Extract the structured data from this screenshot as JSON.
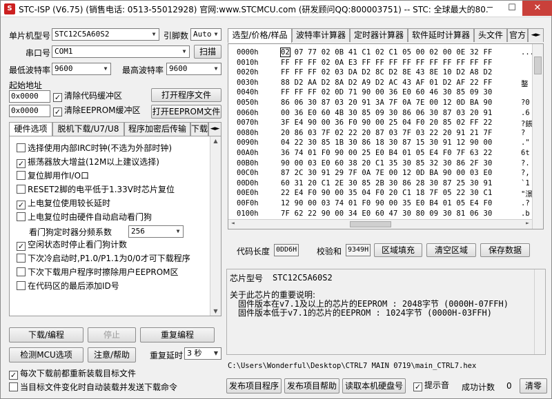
{
  "window": {
    "title": "STC-ISP (V6.75) (销售电话: 0513-55012928) 官网:www.STCMCU.com  (研发顾问QQ:800003751)  -- STC: 全球最大的80...",
    "min": "─",
    "max": "☐",
    "close": "✕"
  },
  "left": {
    "mcu_type_label": "单片机型号",
    "mcu_type_value": "STC12C5A60S2",
    "pins_label": "引脚数",
    "pins_value": "Auto",
    "port_label": "串口号",
    "port_value": "COM1",
    "scan_button": "扫描",
    "min_baud_label": "最低波特率",
    "min_baud_value": "9600",
    "max_baud_label": "最高波特率",
    "max_baud_value": "9600",
    "start_addr_label": "起始地址",
    "code_addr": "0x0000",
    "clear_code_label": "清除代码缓冲区",
    "open_program_button": "打开程序文件",
    "eeprom_addr": "0x0000",
    "clear_eeprom_label": "清除EEPROM缓冲区",
    "open_eeprom_button": "打开EEPROM文件"
  },
  "left_tabs": [
    "硬件选项",
    "脱机下载/U7/U8",
    "程序加密后传输",
    "下载"
  ],
  "options": [
    {
      "label": "选择使用内部IRC时钟(不选为外部时钟)",
      "checked": false
    },
    {
      "label": "振荡器放大增益(12M以上建议选择)",
      "checked": true
    },
    {
      "label": "复位脚用作I/O口",
      "checked": false
    },
    {
      "label": "RESET2脚的电平低于1.33V时芯片复位",
      "checked": false
    },
    {
      "label": "上电复位使用较长延时",
      "checked": true
    },
    {
      "label": "上电复位时由硬件自动启动看门狗",
      "checked": false
    }
  ],
  "watchdog": {
    "label": "看门狗定时器分频系数",
    "value": "256"
  },
  "options2": [
    {
      "label": "空闲状态时停止看门狗计数",
      "checked": true
    },
    {
      "label": "下次冷启动时,P1.0/P1.1为0/0才可下载程序",
      "checked": false
    },
    {
      "label": "下次下载用户程序时擦除用户EEPROM区",
      "checked": false
    },
    {
      "label": "在代码区的最后添加ID号",
      "checked": false
    }
  ],
  "actions": {
    "download": "下载/编程",
    "stop": "停止",
    "redownload": "重复编程",
    "check_mcu": "检测MCU选项",
    "help": "注意/帮助",
    "repeat_delay_label": "重复延时",
    "repeat_delay_value": "3 秒",
    "reload_each": "每次下载前都重新装载目标文件",
    "auto_reload": "当目标文件变化时自动装载并发送下载命令"
  },
  "right_tabs": [
    "选型/价格/样品",
    "波特率计算器",
    "定时器计算器",
    "软件延时计算器",
    "头文件",
    "官方"
  ],
  "hex": {
    "rows": [
      {
        "addr": "0000h",
        "bytes": "02 07 77 02 0B 41 C1 02 C1 05 00 02 00 0E 32 FF",
        "ascii": "..."
      },
      {
        "addr": "0010h",
        "bytes": "FF FF FF 02 0A E3 FF FF FF FF FF FF FF FF FF FF",
        "ascii": ""
      },
      {
        "addr": "0020h",
        "bytes": "FF FF FF 02 03 DA D2 8C D2 8E 43 8E 10 D2 A8 D2",
        "ascii": ""
      },
      {
        "addr": "0030h",
        "bytes": "88 D2 AA D2 8A D2 A9 D2 AC 43 AF 01 D2 AF 22 FF",
        "ascii": "鍪"
      },
      {
        "addr": "0040h",
        "bytes": "FF FF FF 02 0D 71 90 00 36 E0 60 46 30 85 09 30",
        "ascii": ""
      },
      {
        "addr": "0050h",
        "bytes": "86 06 30 87 03 20 91 3A 7F 0A 7E 00 12 0D BA 90",
        "ascii": "?0"
      },
      {
        "addr": "0060h",
        "bytes": "00 36 E0 60 4B 30 85 09 30 86 06 30 87 03 20 91",
        "ascii": ".6"
      },
      {
        "addr": "0070h",
        "bytes": "3F E4 90 00 36 F0 90 00 25 04 F0 20 85 02 FF 22",
        "ascii": "?鋹"
      },
      {
        "addr": "0080h",
        "bytes": "20 86 03 7F 02 22 20 87 03 7F 03 22 20 91 21 7F",
        "ascii": " ?"
      },
      {
        "addr": "0090h",
        "bytes": "04 22 30 85 1B 30 86 18 30 87 15 30 91 12 90 00",
        "ascii": ".\""
      },
      {
        "addr": "00A0h",
        "bytes": "36 74 01 F0 90 00 25 E0 B4 01 05 E4 F0 7F 63 22",
        "ascii": "6t"
      },
      {
        "addr": "00B0h",
        "bytes": "90 00 03 E0 60 38 20 C1 35 30 85 32 30 86 2F 30",
        "ascii": "?."
      },
      {
        "addr": "00C0h",
        "bytes": "87 2C 30 91 29 7F 0A 7E 00 12 0D BA 90 00 03 E0",
        "ascii": "?,"
      },
      {
        "addr": "00D0h",
        "bytes": "60 31 20 C1 2E 30 85 2B 30 86 28 30 87 25 30 91",
        "ascii": "`1"
      },
      {
        "addr": "00E0h",
        "bytes": "22 E4 F0 90 00 35 04 F0 20 C1 18 7F 05 22 30 C1",
        "ascii": "\"澋"
      },
      {
        "addr": "00F0h",
        "bytes": "12 90 00 03 74 01 F0 90 00 35 E0 B4 01 05 E4 F0",
        "ascii": ".?"
      },
      {
        "addr": "0100h",
        "bytes": "7F 62 22 90 00 34 E0 60 47 30 80 09 30 81 06 30",
        "ascii": ".b"
      }
    ]
  },
  "hexbar": {
    "code_len_label": "代码长度",
    "code_len_value": "0DD6H",
    "checksum_label": "校验和",
    "checksum_value": "9349H",
    "fill_button": "区域填充",
    "clear_button": "清空区域",
    "save_button": "保存数据"
  },
  "info": {
    "chip_label": "芯片型号",
    "chip_value": "STC12C5A60S2",
    "note_title": "关于此芯片的重要说明:",
    "note1": "固件版本在v7.1及以上的芯片的EEPROM  : 2048字节 (0000H-07FFH)",
    "note2": "固件版本低于v7.1的芯片的EEPROM       : 1024字节 (0000H-03FFH)"
  },
  "path": "C:\\Users\\Wonderful\\Desktop\\CTRL7 MAIN 0719\\main_CTRL7.hex",
  "bottom": {
    "publish_program": "发布项目程序",
    "publish_help": "发布项目帮助",
    "read_disk": "读取本机硬盘号",
    "beep_label": "提示音",
    "success_label": "成功计数",
    "success_value": "0",
    "clear_button": "清零"
  },
  "colors": {
    "title_close": "#c9403a",
    "selection": "#000000"
  }
}
